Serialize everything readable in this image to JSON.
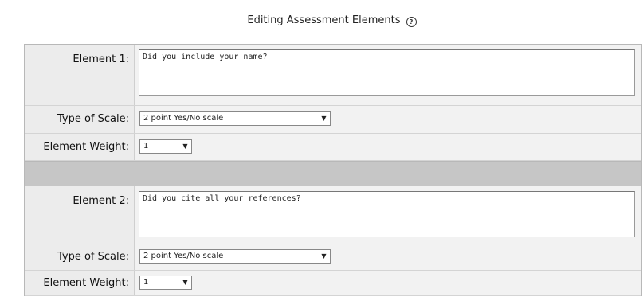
{
  "page": {
    "title": "Editing Assessment Elements",
    "help_icon_glyph": "?"
  },
  "elements": [
    {
      "element_label": "Element 1:",
      "element_text": "Did you include your name?",
      "scale_label": "Type of Scale:",
      "scale_value": "2 point Yes/No scale",
      "weight_label": "Element Weight:",
      "weight_value": "1"
    },
    {
      "element_label": "Element 2:",
      "element_text": "Did you cite all your references?",
      "scale_label": "Type of Scale:",
      "scale_value": "2 point Yes/No scale",
      "weight_label": "Element Weight:",
      "weight_value": "1"
    }
  ],
  "icons": {
    "dropdown_arrow": "▼"
  }
}
